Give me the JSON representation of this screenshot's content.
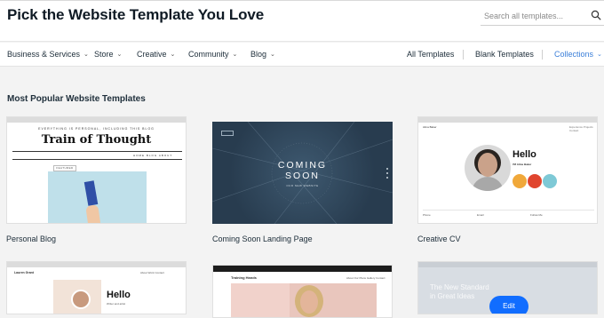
{
  "header": {
    "title": "Pick the Website Template You Love",
    "search_placeholder": "Search all templates..."
  },
  "nav": {
    "categories": [
      {
        "label": "Business & Services"
      },
      {
        "label": "Store"
      },
      {
        "label": "Creative"
      },
      {
        "label": "Community"
      },
      {
        "label": "Blog"
      }
    ],
    "links": [
      {
        "label": "All Templates"
      },
      {
        "label": "Blank Templates"
      },
      {
        "label": "Collections"
      }
    ]
  },
  "section": {
    "title": "Most Popular Website Templates"
  },
  "templates": [
    {
      "label": "Personal Blog",
      "preview": {
        "kicker": "EVERYTHING IS PERSONAL, INCLUDING THIS BLOG",
        "title": "Train of Thought",
        "menu": "HOME  BLOG  ABOUT",
        "badge": "FEATURED POST"
      }
    },
    {
      "label": "Coming Soon Landing Page",
      "preview": {
        "headline_1": "COMING",
        "headline_2": "SOON",
        "sub": "OUR NEW WEBSITE"
      }
    },
    {
      "label": "Creative CV",
      "preview": {
        "name": "Alma Baker",
        "links": "Experience  Projects  Contact",
        "hello": "Hello",
        "tag": "I'M Alma Baker",
        "footer": [
          "Phone",
          "Email",
          "Follow Me"
        ]
      }
    },
    {
      "label": "",
      "preview": {
        "brand": "Lauren Grant",
        "links": "About  Work  Contact",
        "hello": "Hello",
        "sub": "Writer and artist"
      }
    },
    {
      "label": "",
      "preview": {
        "brand": "Training Hands",
        "links": "About  Our Plans  Gallery  Contact"
      }
    },
    {
      "label": "",
      "preview": {
        "text": "The New Standard\nin Great Ideas",
        "edit": "Edit"
      }
    }
  ],
  "colors": {
    "accent": "#3b7fd9",
    "edit_button": "#116dff",
    "cv_dots": [
      "#f0a83a",
      "#e0452e",
      "#7ec9d6"
    ]
  }
}
